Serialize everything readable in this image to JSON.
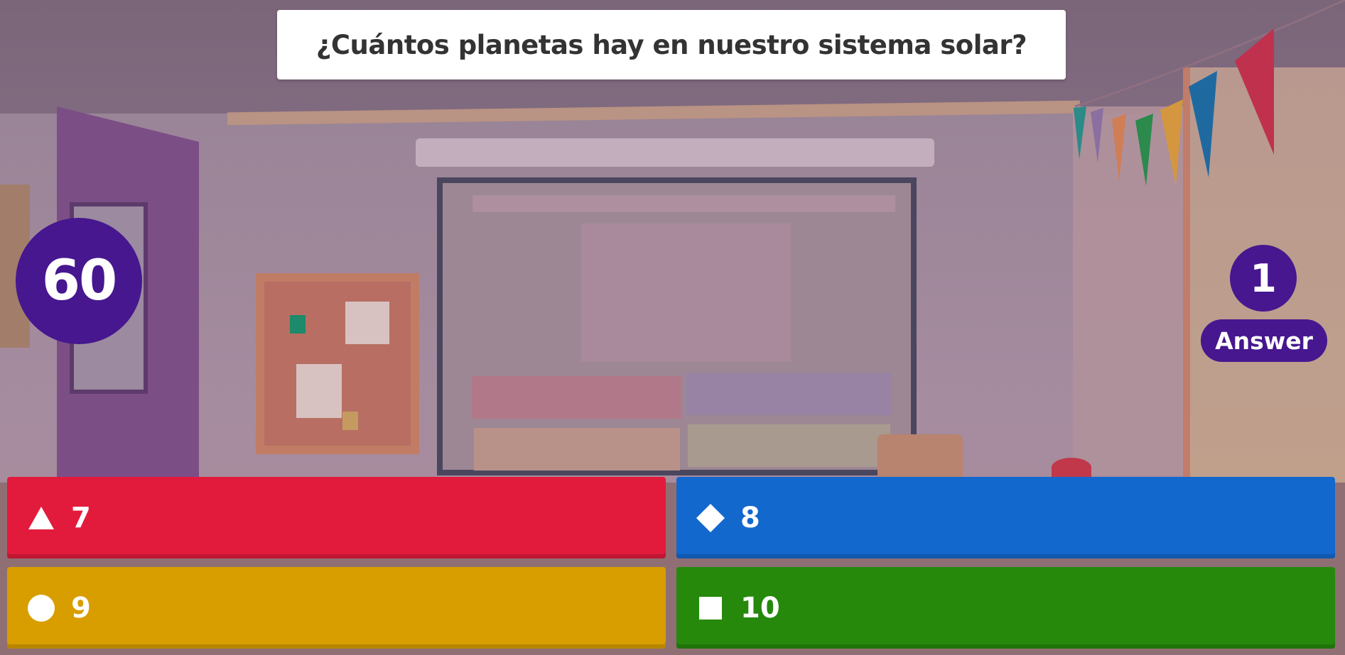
{
  "question": {
    "text": "¿Cuántos planetas hay en nuestro sistema solar?"
  },
  "timer": {
    "seconds": "60"
  },
  "answers_counter": {
    "count": "1",
    "label": "Answer"
  },
  "options": [
    {
      "label": "7",
      "shape": "triangle-icon",
      "color": "#e21b3c"
    },
    {
      "label": "8",
      "shape": "diamond-icon",
      "color": "#1368ce"
    },
    {
      "label": "9",
      "shape": "circle-icon",
      "color": "#d89e00"
    },
    {
      "label": "10",
      "shape": "square-icon",
      "color": "#26890c"
    }
  ],
  "colors": {
    "accent": "#46178f"
  }
}
